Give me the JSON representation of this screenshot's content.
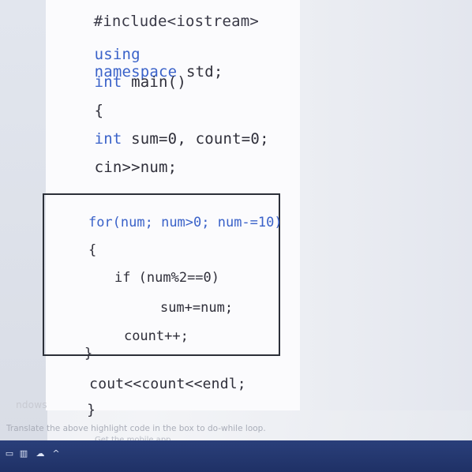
{
  "code": {
    "line0": "#include<iostream>",
    "line1_kw1": "using",
    "line1_kw2": "namespace",
    "line1_rest": " std;",
    "line2_kw": "int",
    "line2_rest": " main()",
    "line3": "{",
    "line4_kw": "int",
    "line4_rest": " sum=0, count=0;",
    "line5": "cin>>num;",
    "after_box": "cout<<count<<endl;",
    "closing_brace": "}",
    "faded_left": "ndows"
  },
  "highlight_box": {
    "for_kw": "for",
    "for_rest": "(num; num>0; num-=10)",
    "open_brace": "{",
    "if_line": "if (num%2==0)",
    "sum_line": "sum+=num;",
    "count_line": "count++;",
    "close_brace": "}"
  },
  "instruction": "Translate the above highlight code in the box to do-while loop.",
  "mobile_prompt": "Get the mobile app",
  "taskbar": {
    "icons": [
      "network-icon",
      "battery-icon",
      "cloud-icon",
      "chevron-up-icon"
    ],
    "glyphs": [
      "▭",
      "▥",
      "☁",
      "^"
    ]
  },
  "colors": {
    "keyword": "#3a62c9",
    "code_text": "#2f2f3a",
    "taskbar": "#24376f"
  }
}
